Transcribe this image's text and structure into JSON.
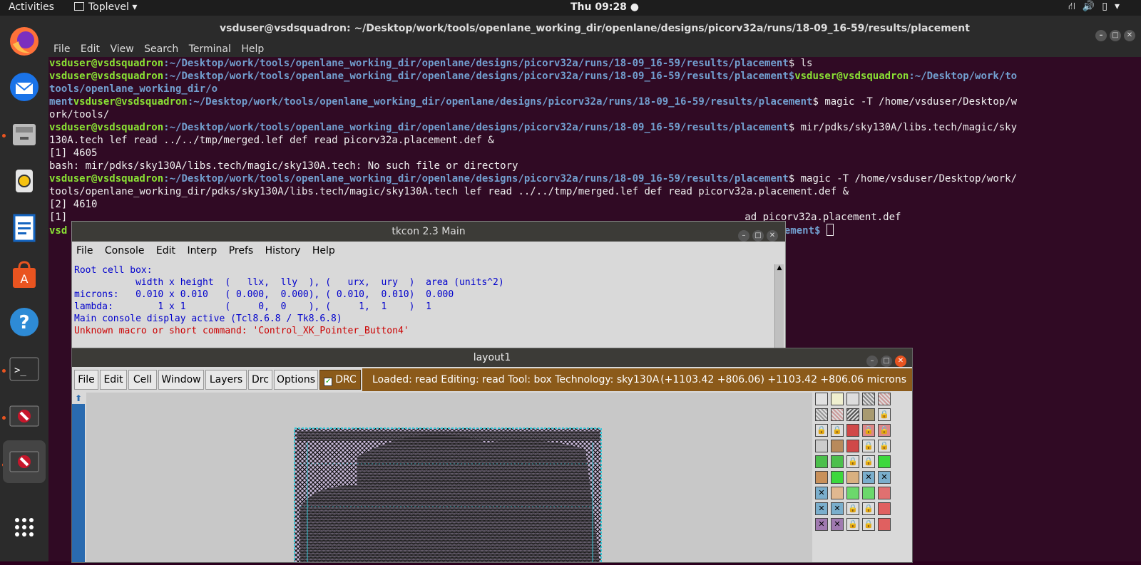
{
  "topbar": {
    "activities": "Activities",
    "toplevel": "Toplevel ▾",
    "clock": "Thu 09:28 ●",
    "tray_icons": [
      "network-icon",
      "volume-icon",
      "battery-icon",
      "menu-arrow-icon"
    ]
  },
  "dock": {
    "items": [
      "firefox-icon",
      "thunderbird-icon",
      "files-icon",
      "rhythmbox-icon",
      "writer-icon",
      "software-icon",
      "help-icon",
      "terminal-icon",
      "blocked-app-icon",
      "blocked-app-icon"
    ],
    "show_apps": "show-applications-icon"
  },
  "terminal": {
    "title": "vsduser@vsdsquadron: ~/Desktop/work/tools/openlane_working_dir/openlane/designs/picorv32a/runs/18-09_16-59/results/placement",
    "menu": [
      "File",
      "Edit",
      "View",
      "Search",
      "Terminal",
      "Help"
    ],
    "prompt_user": "vsduser@vsdsquadron",
    "prompt_path": ":~/Desktop/work/tools/openlane_working_dir/openlane/designs/picorv32a/runs/18-09_16-59/results/placement",
    "lines": {
      "l1_cmd": "$ ls",
      "l2a_cmd": "tools/openlane_working_dir/o",
      "l2_wrap_prefix": "ment",
      "l3_cmd": "$ magic -T /home/vsduser/Desktop/w",
      "l3_wrap": "ork/tools/",
      "l4_cmd": "$ mir/pdks/sky130A/libs.tech/magic/sky",
      "l4_wrap": "130A.tech lef read ../../tmp/merged.lef def read picorv32a.placement.def &",
      "job1": "[1] 4605",
      "bash_err": "bash: mir/pdks/sky130A/libs.tech/magic/sky130A.tech: No such file or directory",
      "l5_cmd": "$ magic -T /home/vsduser/Desktop/work/",
      "l5_wrap": "tools/openlane_working_dir/pdks/sky130A/libs.tech/magic/sky130A.tech lef read ../../tmp/merged.lef def read picorv32a.placement.def &",
      "job2": "[2] 4610",
      "job1_exit_prefix": "[1]",
      "job1_exit_tail": "ad picorv32a.placement.def",
      "last_prefix": "vsd",
      "last_tail": "s/placement$ "
    }
  },
  "tkcon": {
    "title": "tkcon 2.3 Main",
    "menu": [
      "File",
      "Console",
      "Edit",
      "Interp",
      "Prefs",
      "History",
      "Help"
    ],
    "console": [
      "Root cell box:",
      "           width x height  (   llx,  lly  ), (   urx,  ury  )  area (units^2)",
      "",
      "microns:   0.010 x 0.010   ( 0.000,  0.000), ( 0.010,  0.010)  0.000",
      "lambda:        1 x 1       (     0,  0    ), (     1,  1    )  1",
      "Main console display active (Tcl8.6.8 / Tk8.6.8)"
    ],
    "error_line": "Unknown macro or short command: 'Control_XK_Pointer_Button4'"
  },
  "layout": {
    "title": "layout1",
    "menu": [
      "File",
      "Edit",
      "Cell",
      "Window",
      "Layers",
      "Drc",
      "Options"
    ],
    "drc_label": "DRC",
    "drc_checked": true,
    "status_left": "Loaded: read Editing: read Tool: box  Technology: sky130A",
    "status_right": "(+1103.42 +806.06) +1103.42 +806.06 microns"
  },
  "colors": {
    "terminal_bg": "#300a24",
    "prompt_user": "#8ae234",
    "prompt_path": "#729fcf",
    "status_bg": "#8b5a1a",
    "console_text": "#0000cc"
  }
}
